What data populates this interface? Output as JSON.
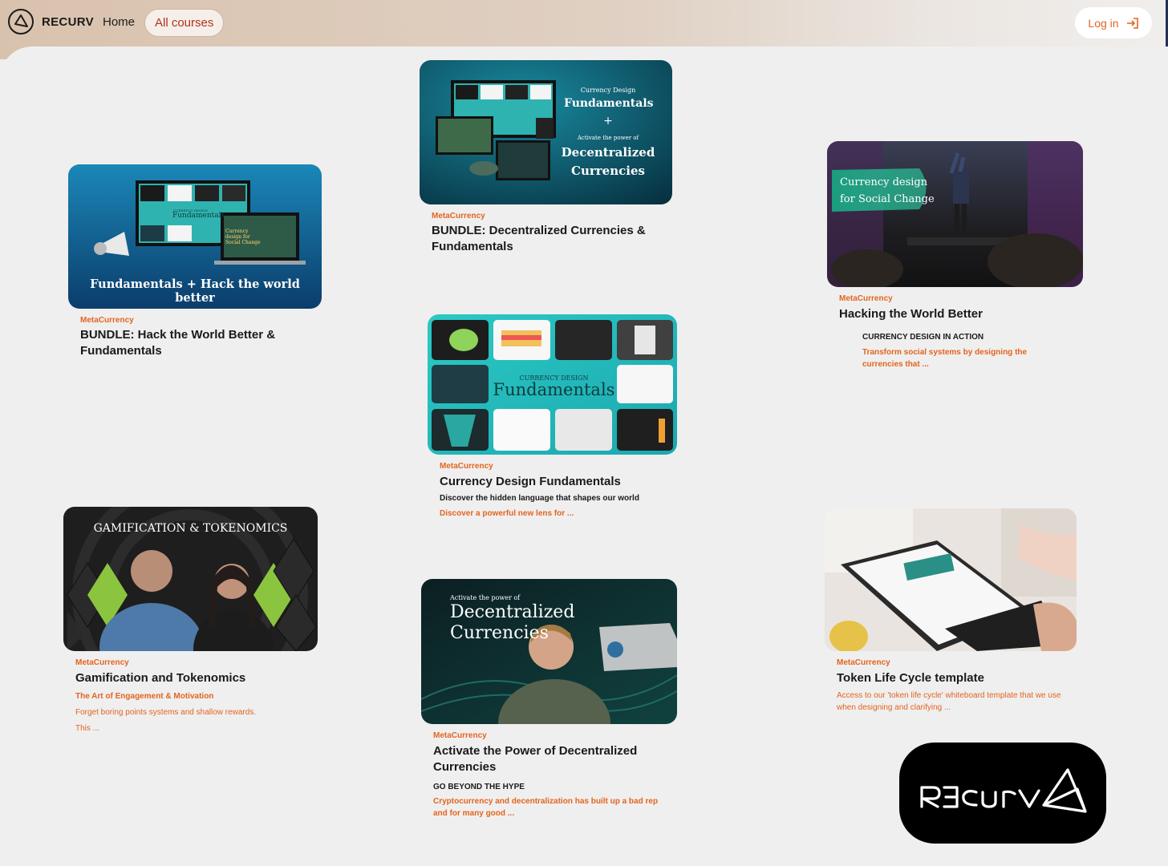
{
  "header": {
    "logo_text": "RECURV",
    "nav_home": "Home",
    "nav_all_courses": "All courses",
    "login_label": "Log in"
  },
  "colors": {
    "accent": "#e4641e",
    "brand_red": "#b0321c"
  },
  "cards": [
    {
      "brand": "MetaCurrency",
      "title": "BUNDLE: Hack the World Better & Fundamentals",
      "thumb_caption": "Fundamentals + Hack the world better",
      "thumb_small": "CURRENCY DESIGN",
      "thumb_mid": "Fundamentals",
      "thumb_laptop": "Currency design for Social Change"
    },
    {
      "brand": "MetaCurrency",
      "title": "BUNDLE: Decentralized Currencies & Fundamentals",
      "thumb_line1": "Currency Design",
      "thumb_line2": "Fundamentals",
      "thumb_plus": "+",
      "thumb_line3": "Activate the power of",
      "thumb_line4": "Decentralized",
      "thumb_line5": "Currencies"
    },
    {
      "brand": "MetaCurrency",
      "title": "Hacking the World Better",
      "subtitle": "CURRENCY DESIGN IN ACTION",
      "description": "Transform social systems by designing the currencies that ...",
      "thumb_line1": "Currency design",
      "thumb_line2": "for Social Change"
    },
    {
      "brand": "MetaCurrency",
      "title": "Currency Design Fundamentals",
      "subtitle": "Discover the hidden language that shapes our world",
      "description": "Discover a powerful new lens for ...",
      "thumb_small": "CURRENCY DESIGN",
      "thumb_big": "Fundamentals"
    },
    {
      "brand": "MetaCurrency",
      "title": "Gamification and Tokenomics",
      "subtitle": "The Art of Engagement & Motivation",
      "description_1": "Forget boring points systems and shallow rewards.",
      "description_2": "This ...",
      "thumb_title": "GAMIFICATION & TOKENOMICS"
    },
    {
      "brand": "MetaCurrency",
      "title": "Activate the Power of Decentralized Currencies",
      "subtitle": "GO BEYOND THE HYPE",
      "description": "Cryptocurrency and decentralization has built up a bad rep and for many good ...",
      "thumb_small": "Activate the power of",
      "thumb_line1": "Decentralized",
      "thumb_line2": "Currencies"
    },
    {
      "brand": "MetaCurrency",
      "title": "Token Life Cycle template",
      "description": "Access to our 'token life cycle' whiteboard template that we use when designing and clarifying ..."
    }
  ],
  "badge": {
    "logo_name": "recurv-logo"
  }
}
